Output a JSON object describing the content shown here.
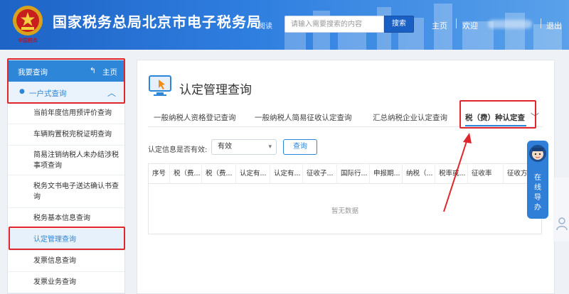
{
  "header": {
    "title": "国家税务总局北京市电子税务局",
    "emblem_caption": "中国税务",
    "read_label": "阅读",
    "search_placeholder": "请输入需要搜索的内容",
    "search_button": "搜索",
    "nav_home": "主页",
    "nav_welcome": "欢迎",
    "nav_logout": "退出"
  },
  "sidebar": {
    "title": "我要查询",
    "home_link": "主页",
    "group_label": "一户式查询",
    "items": [
      {
        "label": "当前年度信用预评价查询"
      },
      {
        "label": "车辆购置税完税证明查询"
      },
      {
        "label": "简易注销纳税人未办结涉税事项查询"
      },
      {
        "label": "税务文书电子送达确认书查询"
      },
      {
        "label": "税务基本信息查询"
      },
      {
        "label": "认定管理查询"
      },
      {
        "label": "发票信息查询"
      },
      {
        "label": "发票业务查询"
      }
    ]
  },
  "main": {
    "page_title": "认定管理查询",
    "tabs": [
      {
        "label": "一般纳税人资格登记查询"
      },
      {
        "label": "一般纳税人简易征收认定查询"
      },
      {
        "label": "汇总纳税企业认定查询"
      },
      {
        "label": "税（费）种认定查"
      }
    ],
    "filter": {
      "label": "认定信息是否有效:",
      "value": "有效",
      "query_button": "查询"
    },
    "table": {
      "columns": [
        "序号",
        "税（费...",
        "税（费...",
        "认定有...",
        "认定有...",
        "征收子...",
        "国际行...",
        "申报期...",
        "纳税（...",
        "税率或...",
        "征收率",
        "征收方"
      ],
      "empty_text": "暂无数据"
    }
  },
  "guide": {
    "label_lines": [
      "在",
      "线",
      "导",
      "办"
    ]
  },
  "colors": {
    "header_blue": "#1e63c6",
    "accent": "#2e86d9",
    "highlight_red": "#e0262d"
  }
}
